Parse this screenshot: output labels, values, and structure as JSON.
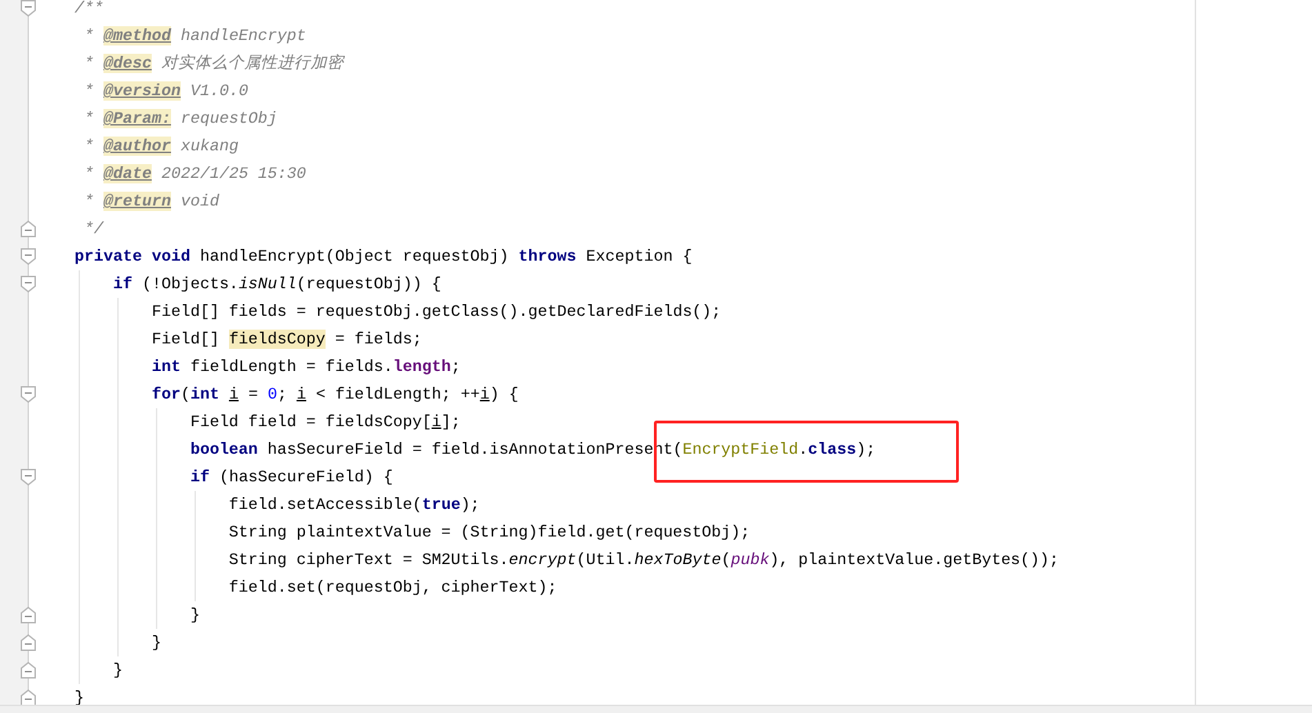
{
  "editor": {
    "lines": [
      {
        "fold_start": true,
        "tokens": [
          {
            "kind": "comment",
            "text": "/**"
          }
        ]
      },
      {
        "tokens": [
          {
            "kind": "comment",
            "text": " * "
          },
          {
            "kind": "doc-tag",
            "text": "@method"
          },
          {
            "kind": "comment",
            "text": " handleEncrypt"
          }
        ]
      },
      {
        "tokens": [
          {
            "kind": "comment",
            "text": " * "
          },
          {
            "kind": "doc-tag",
            "text": "@desc"
          },
          {
            "kind": "comment",
            "text": " 对实体么个属性进行加密"
          }
        ]
      },
      {
        "tokens": [
          {
            "kind": "comment",
            "text": " * "
          },
          {
            "kind": "doc-tag",
            "text": "@version"
          },
          {
            "kind": "comment",
            "text": " V1.0.0"
          }
        ]
      },
      {
        "tokens": [
          {
            "kind": "comment",
            "text": " * "
          },
          {
            "kind": "doc-tag",
            "text": "@Param:"
          },
          {
            "kind": "comment",
            "text": " requestObj"
          }
        ]
      },
      {
        "tokens": [
          {
            "kind": "comment",
            "text": " * "
          },
          {
            "kind": "doc-tag",
            "text": "@author"
          },
          {
            "kind": "comment",
            "text": " xukang"
          }
        ]
      },
      {
        "tokens": [
          {
            "kind": "comment",
            "text": " * "
          },
          {
            "kind": "doc-tag",
            "text": "@date"
          },
          {
            "kind": "comment",
            "text": " 2022/1/25 15:30"
          }
        ]
      },
      {
        "tokens": [
          {
            "kind": "comment",
            "text": " * "
          },
          {
            "kind": "doc-tag",
            "text": "@return"
          },
          {
            "kind": "comment",
            "text": " void"
          }
        ]
      },
      {
        "fold_end": true,
        "tokens": [
          {
            "kind": "comment",
            "text": " */"
          }
        ]
      },
      {
        "fold_start": true,
        "tokens": [
          {
            "kind": "keyword",
            "text": "private"
          },
          {
            "kind": "keyword",
            "text": " void"
          },
          {
            "kind": "plain",
            "text": " handleEncrypt(Object requestObj) "
          },
          {
            "kind": "keyword",
            "text": "throws"
          },
          {
            "kind": "plain",
            "text": " Exception {"
          }
        ]
      },
      {
        "fold_start": true,
        "tokens": [
          {
            "kind": "keyword",
            "text": "    if"
          },
          {
            "kind": "plain",
            "text": " (!Objects."
          },
          {
            "kind": "static-method",
            "text": "isNull"
          },
          {
            "kind": "plain",
            "text": "(requestObj)) {"
          }
        ]
      },
      {
        "tokens": [
          {
            "kind": "plain",
            "text": "        Field[] fields = requestObj.getClass().getDeclaredFields();"
          }
        ]
      },
      {
        "tokens": [
          {
            "kind": "plain",
            "text": "        Field[] "
          },
          {
            "kind": "highlight",
            "text": "fieldsCopy"
          },
          {
            "kind": "plain",
            "text": " = fields;"
          }
        ]
      },
      {
        "tokens": [
          {
            "kind": "keyword",
            "text": "        int"
          },
          {
            "kind": "plain",
            "text": " fieldLength = fields."
          },
          {
            "kind": "field",
            "text": "length"
          },
          {
            "kind": "plain",
            "text": ";"
          }
        ]
      },
      {
        "fold_start": true,
        "tokens": [
          {
            "kind": "keyword",
            "text": "        for"
          },
          {
            "kind": "plain",
            "text": "("
          },
          {
            "kind": "keyword",
            "text": "int "
          },
          {
            "kind": "underlined",
            "text": "i"
          },
          {
            "kind": "plain",
            "text": " = "
          },
          {
            "kind": "number",
            "text": "0"
          },
          {
            "kind": "plain",
            "text": "; "
          },
          {
            "kind": "underlined",
            "text": "i"
          },
          {
            "kind": "plain",
            "text": " < fieldLength; ++"
          },
          {
            "kind": "underlined",
            "text": "i"
          },
          {
            "kind": "plain",
            "text": ") {"
          }
        ]
      },
      {
        "tokens": [
          {
            "kind": "plain",
            "text": "            Field field = fieldsCopy["
          },
          {
            "kind": "underlined",
            "text": "i"
          },
          {
            "kind": "plain",
            "text": "];"
          }
        ]
      },
      {
        "boxed": true,
        "tokens": [
          {
            "kind": "keyword",
            "text": "            boolean"
          },
          {
            "kind": "plain",
            "text": " hasSecureField = field.isAnnotationPresent("
          },
          {
            "kind": "annotation",
            "text": "EncryptField"
          },
          {
            "kind": "plain",
            "text": "."
          },
          {
            "kind": "keyword",
            "text": "class"
          },
          {
            "kind": "plain",
            "text": ");"
          }
        ]
      },
      {
        "fold_start": true,
        "tokens": [
          {
            "kind": "keyword",
            "text": "            if"
          },
          {
            "kind": "plain",
            "text": " (hasSecureField) {"
          }
        ]
      },
      {
        "tokens": [
          {
            "kind": "plain",
            "text": "                field.setAccessible("
          },
          {
            "kind": "keyword",
            "text": "true"
          },
          {
            "kind": "plain",
            "text": ");"
          }
        ]
      },
      {
        "tokens": [
          {
            "kind": "plain",
            "text": "                String plaintextValue = (String)field.get(requestObj);"
          }
        ]
      },
      {
        "tokens": [
          {
            "kind": "plain",
            "text": "                String cipherText = SM2Utils."
          },
          {
            "kind": "static-method",
            "text": "encrypt"
          },
          {
            "kind": "plain",
            "text": "(Util."
          },
          {
            "kind": "static-method",
            "text": "hexToByte"
          },
          {
            "kind": "plain",
            "text": "("
          },
          {
            "kind": "static-field",
            "text": "pubk"
          },
          {
            "kind": "plain",
            "text": "), plaintextValue.getBytes());"
          }
        ]
      },
      {
        "tokens": [
          {
            "kind": "plain",
            "text": "                field.set(requestObj, cipherText);"
          }
        ]
      },
      {
        "fold_end": true,
        "tokens": [
          {
            "kind": "plain",
            "text": "            }"
          }
        ]
      },
      {
        "fold_end": true,
        "tokens": [
          {
            "kind": "plain",
            "text": "        }"
          }
        ]
      },
      {
        "fold_end": true,
        "tokens": [
          {
            "kind": "plain",
            "text": "    }"
          }
        ]
      },
      {
        "fold_end": true,
        "tokens": [
          {
            "kind": "plain",
            "text": "}"
          }
        ]
      }
    ]
  }
}
